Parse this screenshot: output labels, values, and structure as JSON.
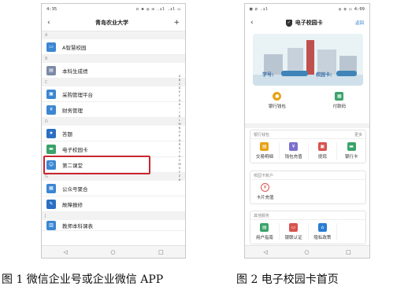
{
  "left_phone": {
    "status_time": "4:35",
    "status_right": "◻ ✱ ◎ ✉ .ıl .ıl ▭",
    "title": "青岛农业大学",
    "back_icon": "‹",
    "add_icon": "+",
    "sections": [
      {
        "letter": "A",
        "items": [
          "A智慧校园"
        ]
      },
      {
        "letter": "B",
        "items": [
          "本科生成绩"
        ]
      },
      {
        "letter": "C",
        "items": [
          "采购管理平台",
          "财务管理"
        ]
      },
      {
        "letter": "D",
        "items": [
          "答题",
          "电子校园卡",
          "第二课堂"
        ]
      },
      {
        "letter": "G",
        "items": [
          "公众号聚合",
          "故障报修"
        ]
      },
      {
        "letter": "J",
        "items": [
          "教师本科课表"
        ]
      }
    ],
    "index_letters": "ABCDEFGHIJKLMNOPQRSTUVWXYZ#",
    "nav": [
      "◁",
      "○",
      "□"
    ],
    "colors": {
      "highlight": "#c9262d",
      "icon_blue": "#3b86d3"
    }
  },
  "right_phone": {
    "status_left": "▦ ⇄ .ıl",
    "status_right": "◎ ✪ ▭ 4:09",
    "back_icon": "‹",
    "title": "电子校园卡",
    "title_icon": "shield",
    "more": "返回",
    "banner_labels": {
      "student_no": "学号:",
      "balance": "校园卡:"
    },
    "quick": [
      "银行钱包",
      "付款码"
    ],
    "sections": [
      {
        "title": "银行钱包",
        "more": "更多",
        "items": [
          "交易明细",
          "钱包充值",
          "提现",
          "银行卡"
        ]
      },
      {
        "title": "校园卡账户",
        "more": "",
        "items": [
          "卡片充值"
        ]
      },
      {
        "title": "其他服务",
        "more": "",
        "items": [
          "用户指南",
          "银联认证",
          "隐私政策"
        ]
      }
    ],
    "nav": [
      "◁",
      "○",
      "□"
    ]
  },
  "captions": {
    "left": "图 1 微信企业号或企业微信 APP",
    "right": "图 2  电子校园卡首页"
  }
}
